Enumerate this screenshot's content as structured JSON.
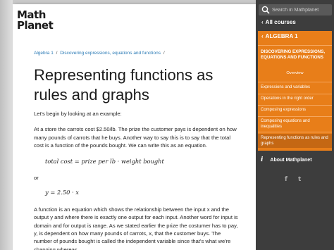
{
  "logo": {
    "line1": "Math",
    "line2": "Planet"
  },
  "breadcrumb": {
    "items": [
      "Algebra 1",
      "Discovering expressions, equations and functions"
    ],
    "separator": "/"
  },
  "page": {
    "title": "Representing functions as rules and graphs",
    "intro": "Let's begin by looking at an example:",
    "para1": "Let's begin by looking at an example:",
    "para2": "At a store the carrots cost $2.50/lb. The prize the customer pays is dependent on how many pounds of carrots that he buys. Another way to say this is to say that the total cost is a function of the pounds bought. We can write this as an equation.",
    "formula1": "total cost = prize per lb · weight bought",
    "or": "or",
    "formula2": "y = 2.50 · x",
    "para3": "A function is an equation which shows the relationship between the input x and the output y and where there is exactly one output for each input. Another word for input is domain and for output is range. As we stated earlier the prize the costumer has to pay, y, is dependent on how many pounds of carrots, x, that the customer buys. The number of pounds bought is called the independent variable since that's what we're changing whereas"
  },
  "sidebar": {
    "search_placeholder": "Search in Mathplanet",
    "all_courses": "All courses",
    "course": "ALGEBRA 1",
    "section": "DISCOVERING EXPRESSIONS, EQUATIONS AND FUNCTIONS",
    "overview": "Overview",
    "topics": [
      "Expressions and variables",
      "Operations in the right order",
      "Composing expressions",
      "Composing equations and inequalities",
      "Representing functions as rules and graphs"
    ],
    "about": "About Mathplanet",
    "social": [
      "f",
      "t"
    ]
  },
  "colors": {
    "accent": "#e87e19",
    "sidebar": "#3d3d3d",
    "link": "#2a7ab5",
    "active_topic": "#c46713"
  },
  "icons": [
    "search-icon",
    "chevron-left-icon",
    "info-icon",
    "facebook-icon",
    "twitter-icon"
  ]
}
